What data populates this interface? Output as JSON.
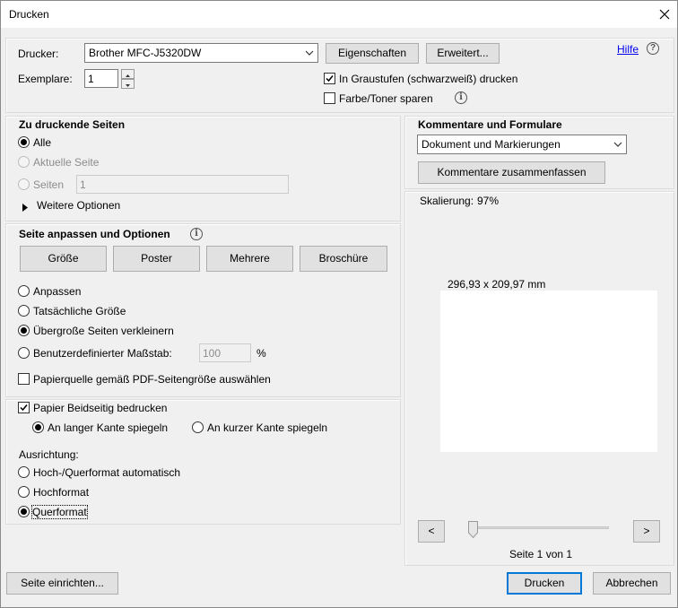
{
  "window": {
    "title": "Drucken"
  },
  "top": {
    "printer_label": "Drucker:",
    "printer_value": "Brother MFC-J5320DW",
    "properties_button": "Eigenschaften",
    "advanced_button": "Erweitert...",
    "help_link": "Hilfe",
    "copies_label": "Exemplare:",
    "copies_value": "1",
    "grayscale_label": "In Graustufen (schwarzweiß) drucken",
    "grayscale_checked": true,
    "save_toner_label": "Farbe/Toner sparen",
    "save_toner_checked": false
  },
  "pages": {
    "heading": "Zu druckende Seiten",
    "all_label": "Alle",
    "current_label": "Aktuelle Seite",
    "pages_label": "Seiten",
    "pages_value": "1",
    "more_options": "Weitere Optionen"
  },
  "fit": {
    "heading": "Seite anpassen und Optionen",
    "size_button": "Größe",
    "poster_button": "Poster",
    "multiple_button": "Mehrere",
    "booklet_button": "Broschüre",
    "fit_label": "Anpassen",
    "actual_label": "Tatsächliche Größe",
    "shrink_label": "Übergroße Seiten verkleinern",
    "custom_label": "Benutzerdefinierter Maßstab:",
    "custom_value": "100",
    "percent": "%",
    "paper_source_label": "Papierquelle gemäß PDF-Seitengröße auswählen"
  },
  "duplex": {
    "duplex_label": "Papier Beidseitig bedrucken",
    "long_edge_label": "An langer Kante spiegeln",
    "short_edge_label": "An kurzer Kante spiegeln",
    "orientation_label": "Ausrichtung:",
    "auto_label": "Hoch-/Querformat automatisch",
    "portrait_label": "Hochformat",
    "landscape_label": "Querformat"
  },
  "comments": {
    "heading": "Kommentare und Formulare",
    "select_value": "Dokument und Markierungen",
    "summarize_button": "Kommentare zusammenfassen"
  },
  "preview": {
    "scaling_label": "Skalierung:",
    "scaling_value": "97%",
    "dimensions": "296,93 x 209,97 mm",
    "prev_button": "<",
    "next_button": ">",
    "page_status": "Seite 1 von 1"
  },
  "footer": {
    "page_setup_button": "Seite einrichten...",
    "print_button": "Drucken",
    "cancel_button": "Abbrechen"
  },
  "colors": {
    "accent": "#0078d7",
    "link": "#0000ee"
  }
}
